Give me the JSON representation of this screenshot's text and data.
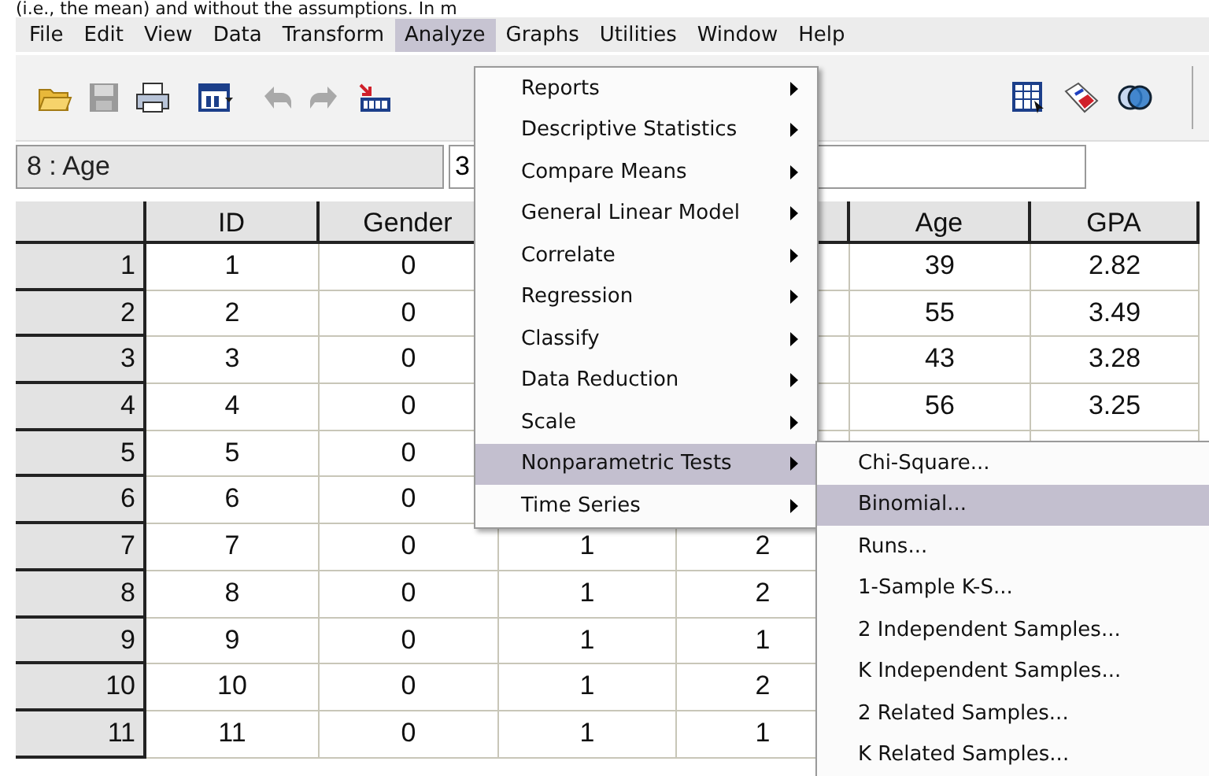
{
  "document_text": "(i.e., the mean) and without the assumptions. In m",
  "menubar": [
    {
      "label": "File",
      "selected": false
    },
    {
      "label": "Edit",
      "selected": false
    },
    {
      "label": "View",
      "selected": false
    },
    {
      "label": "Data",
      "selected": false
    },
    {
      "label": "Transform",
      "selected": false
    },
    {
      "label": "Analyze",
      "selected": true
    },
    {
      "label": "Graphs",
      "selected": false
    },
    {
      "label": "Utilities",
      "selected": false
    },
    {
      "label": "Window",
      "selected": false
    },
    {
      "label": "Help",
      "selected": false
    }
  ],
  "cell_editor": {
    "cell_name": "8 : Age",
    "value": "3"
  },
  "table": {
    "columns": [
      "ID",
      "Gender",
      null,
      null,
      "Age",
      "GPA"
    ],
    "rows": [
      {
        "header": "1",
        "cells": [
          "1",
          "0",
          null,
          null,
          "39",
          "2.82"
        ]
      },
      {
        "header": "2",
        "cells": [
          "2",
          "0",
          null,
          null,
          "55",
          "3.49"
        ]
      },
      {
        "header": "3",
        "cells": [
          "3",
          "0",
          null,
          null,
          "43",
          "3.28"
        ]
      },
      {
        "header": "4",
        "cells": [
          "4",
          "0",
          null,
          null,
          "56",
          "3.25"
        ]
      },
      {
        "header": "5",
        "cells": [
          "5",
          "0",
          null,
          null,
          null,
          null
        ]
      },
      {
        "header": "6",
        "cells": [
          "6",
          "0",
          null,
          null,
          null,
          null
        ]
      },
      {
        "header": "7",
        "cells": [
          "7",
          "0",
          "1",
          "2",
          null,
          null
        ]
      },
      {
        "header": "8",
        "cells": [
          "8",
          "0",
          "1",
          "2",
          null,
          null
        ]
      },
      {
        "header": "9",
        "cells": [
          "9",
          "0",
          "1",
          "1",
          null,
          null
        ]
      },
      {
        "header": "10",
        "cells": [
          "10",
          "0",
          "1",
          "2",
          null,
          null
        ]
      },
      {
        "header": "11",
        "cells": [
          "11",
          "0",
          "1",
          "1",
          null,
          null
        ]
      }
    ]
  },
  "analyze_menu": [
    {
      "label": "Reports",
      "selected": false,
      "submenu": true
    },
    {
      "label": "Descriptive Statistics",
      "selected": false,
      "submenu": true
    },
    {
      "label": "Compare Means",
      "selected": false,
      "submenu": true
    },
    {
      "label": "General Linear Model",
      "selected": false,
      "submenu": true
    },
    {
      "label": "Correlate",
      "selected": false,
      "submenu": true
    },
    {
      "label": "Regression",
      "selected": false,
      "submenu": true
    },
    {
      "label": "Classify",
      "selected": false,
      "submenu": true
    },
    {
      "label": "Data Reduction",
      "selected": false,
      "submenu": true
    },
    {
      "label": "Scale",
      "selected": false,
      "submenu": true
    },
    {
      "label": "Nonparametric Tests",
      "selected": true,
      "submenu": true
    },
    {
      "label": "Time Series",
      "selected": false,
      "submenu": true
    }
  ],
  "nonparametric_submenu": [
    {
      "label": "Chi-Square...",
      "selected": false
    },
    {
      "label": "Binomial...",
      "selected": true
    },
    {
      "label": "Runs...",
      "selected": false
    },
    {
      "label": "1-Sample K-S...",
      "selected": false
    },
    {
      "label": "2 Independent Samples...",
      "selected": false
    },
    {
      "label": "K Independent Samples...",
      "selected": false
    },
    {
      "label": "2 Related Samples...",
      "selected": false
    },
    {
      "label": "K Related Samples...",
      "selected": false
    }
  ]
}
